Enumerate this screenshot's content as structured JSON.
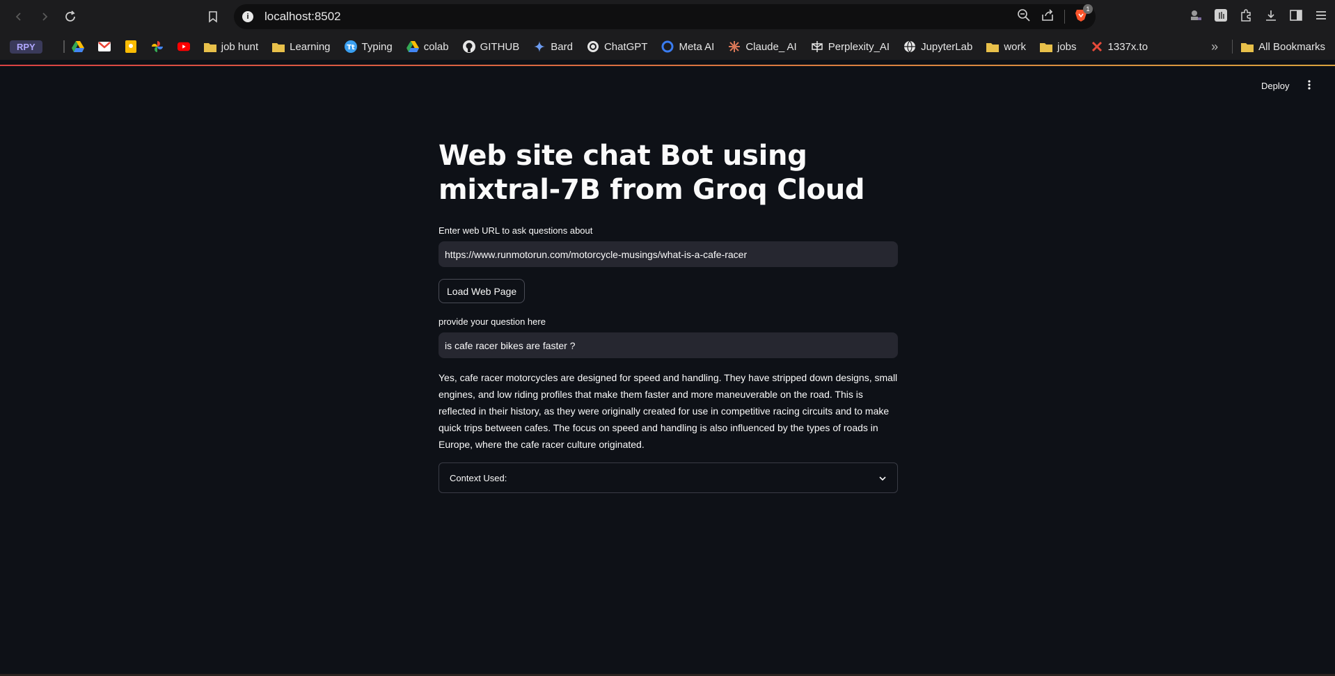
{
  "browser": {
    "url": "localhost:8502",
    "brave_badge_count": "1",
    "bookmarks": [
      {
        "label": "RPY",
        "icon": "pill-label"
      },
      {
        "label": "",
        "icon": "google-drive-icon"
      },
      {
        "label": "",
        "icon": "gmail-icon"
      },
      {
        "label": "",
        "icon": "google-keep-icon"
      },
      {
        "label": "",
        "icon": "google-photos-icon"
      },
      {
        "label": "",
        "icon": "youtube-icon"
      },
      {
        "label": "job hunt",
        "icon": "folder-icon"
      },
      {
        "label": "Learning",
        "icon": "folder-icon"
      },
      {
        "label": "Typing",
        "icon": "typing-icon"
      },
      {
        "label": "colab",
        "icon": "google-drive-icon"
      },
      {
        "label": "GITHUB",
        "icon": "github-icon"
      },
      {
        "label": "Bard",
        "icon": "bard-icon"
      },
      {
        "label": "ChatGPT",
        "icon": "chatgpt-icon"
      },
      {
        "label": "Meta AI",
        "icon": "meta-ai-icon"
      },
      {
        "label": "Claude_ AI",
        "icon": "claude-icon"
      },
      {
        "label": "Perplexity_AI",
        "icon": "perplexity-icon"
      },
      {
        "label": "JupyterLab",
        "icon": "globe-icon"
      },
      {
        "label": "work",
        "icon": "folder-icon"
      },
      {
        "label": "jobs",
        "icon": "folder-icon"
      },
      {
        "label": "1337x.to",
        "icon": "x-icon"
      }
    ],
    "all_bookmarks_label": "All Bookmarks"
  },
  "app": {
    "deploy_label": "Deploy",
    "title": "Web site chat Bot using mixtral-7B from Groq Cloud",
    "url_field": {
      "label": "Enter web URL to ask questions about",
      "value": "https://www.runmotorun.com/motorcycle-musings/what-is-a-cafe-racer"
    },
    "load_button_label": "Load Web Page",
    "question_field": {
      "label": "provide your question here",
      "value": "is cafe racer bikes are faster ?"
    },
    "answer": "Yes, cafe racer motorcycles are designed for speed and handling. They have stripped down designs, small engines, and low riding profiles that make them faster and more maneuverable on the road. This is reflected in their history, as they were originally created for use in competitive racing circuits and to make quick trips between cafes. The focus on speed and handling is also influenced by the types of roads in Europe, where the cafe racer culture originated.",
    "expander_label": "Context Used:"
  },
  "colors": {
    "background": "#0e1117",
    "input_bg": "#262730",
    "chrome_bg": "#1c1c1e"
  }
}
